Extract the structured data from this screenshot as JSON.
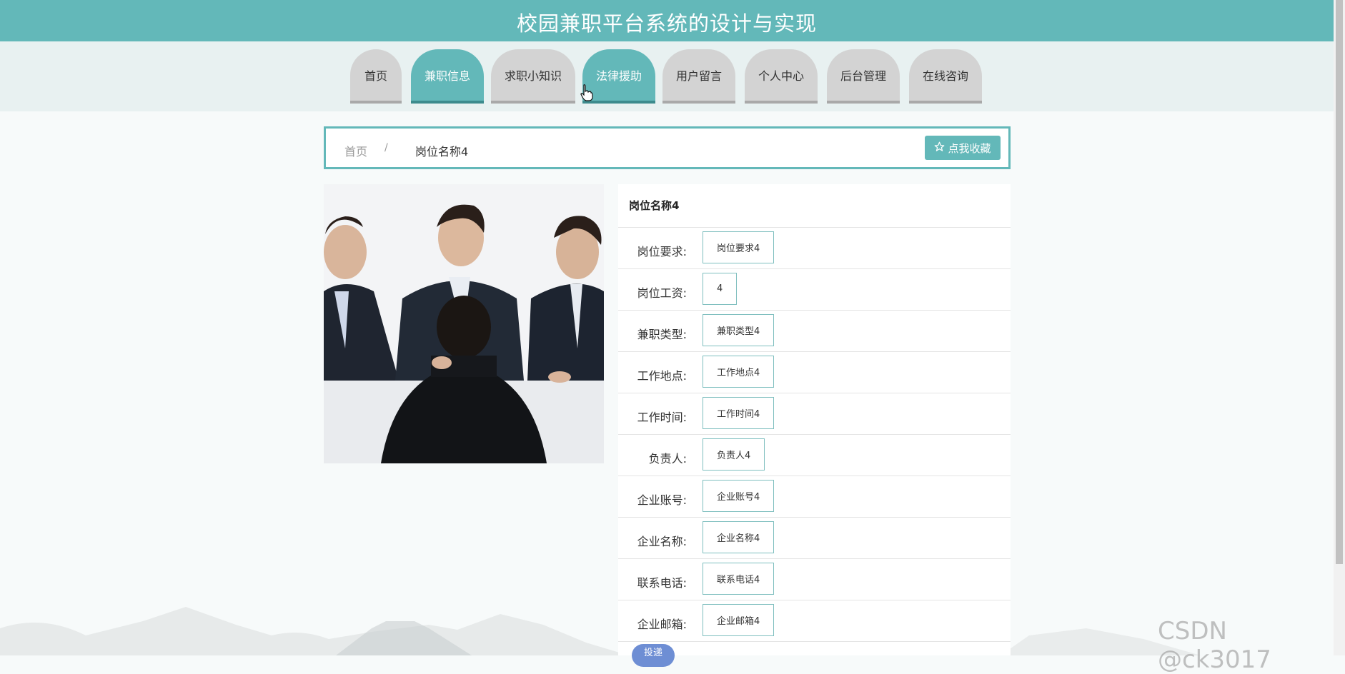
{
  "header": {
    "title": "校园兼职平台系统的设计与实现"
  },
  "nav": {
    "items": [
      {
        "label": "首页",
        "active": false
      },
      {
        "label": "兼职信息",
        "active": true
      },
      {
        "label": "求职小知识",
        "active": false
      },
      {
        "label": "法律援助",
        "active": true
      },
      {
        "label": "用户留言",
        "active": false
      },
      {
        "label": "个人中心",
        "active": false
      },
      {
        "label": "后台管理",
        "active": false
      },
      {
        "label": "在线咨询",
        "active": false
      }
    ]
  },
  "breadcrumb": {
    "home": "首页",
    "separator": "/",
    "current": "岗位名称4"
  },
  "favorite_button": {
    "label": "点我收藏",
    "icon": "star-outline-icon"
  },
  "detail": {
    "title": "岗位名称4",
    "fields": [
      {
        "label": "岗位要求:",
        "value": "岗位要求4"
      },
      {
        "label": "岗位工资:",
        "value": "4"
      },
      {
        "label": "兼职类型:",
        "value": "兼职类型4"
      },
      {
        "label": "工作地点:",
        "value": "工作地点4"
      },
      {
        "label": "工作时间:",
        "value": "工作时间4"
      },
      {
        "label": "负责人:",
        "value": "负责人4"
      },
      {
        "label": "企业账号:",
        "value": "企业账号4"
      },
      {
        "label": "企业名称:",
        "value": "企业名称4"
      },
      {
        "label": "联系电话:",
        "value": "联系电话4"
      },
      {
        "label": "企业邮箱:",
        "value": "企业邮箱4"
      }
    ]
  },
  "bottom_button": {
    "label": "投递"
  },
  "watermark": "CSDN @ck3017",
  "colors": {
    "primary": "#63b8b9",
    "tab_inactive": "#d3d3d3",
    "button_blue": "#6e8ed4"
  }
}
